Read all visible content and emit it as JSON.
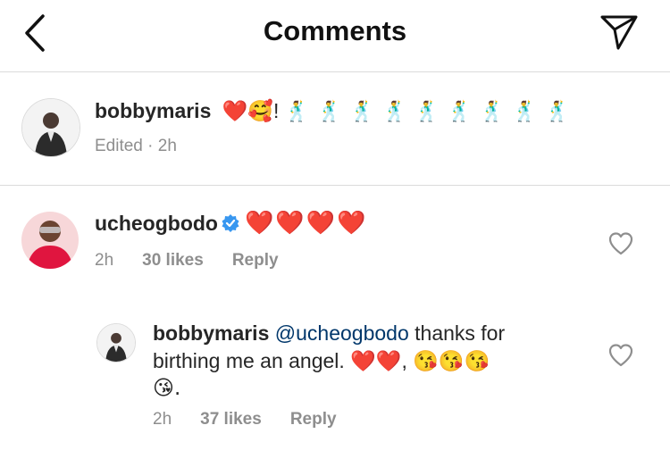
{
  "header": {
    "title": "Comments"
  },
  "caption": {
    "username": "bobbymaris",
    "text_hearts": "❤️",
    "text_smile": "🥰",
    "text_excl": "!",
    "text_dancers": "🕺🕺🕺🕺🕺🕺🕺🕺🕺",
    "meta": "Edited · 2h"
  },
  "comment": {
    "username": "ucheogbodo",
    "text": "❤️❤️❤️❤️",
    "time": "2h",
    "likes": "30 likes",
    "reply_label": "Reply"
  },
  "reply": {
    "username": "bobbymaris",
    "mention": "@ucheogbodo",
    "text_line1": "thanks for",
    "text_line2": "birthing me an angel. ❤️❤️, 😘😘😘",
    "text_line3": "😘.",
    "time": "2h",
    "likes": "37 likes",
    "reply_label": "Reply"
  },
  "colors": {
    "accent": "#3897f0",
    "muted": "#8e8e8e",
    "divider": "#dbdbdb",
    "heart": "#e0245e"
  },
  "icons": [
    "back-icon",
    "send-icon",
    "verified-icon",
    "heart-outline-icon"
  ]
}
